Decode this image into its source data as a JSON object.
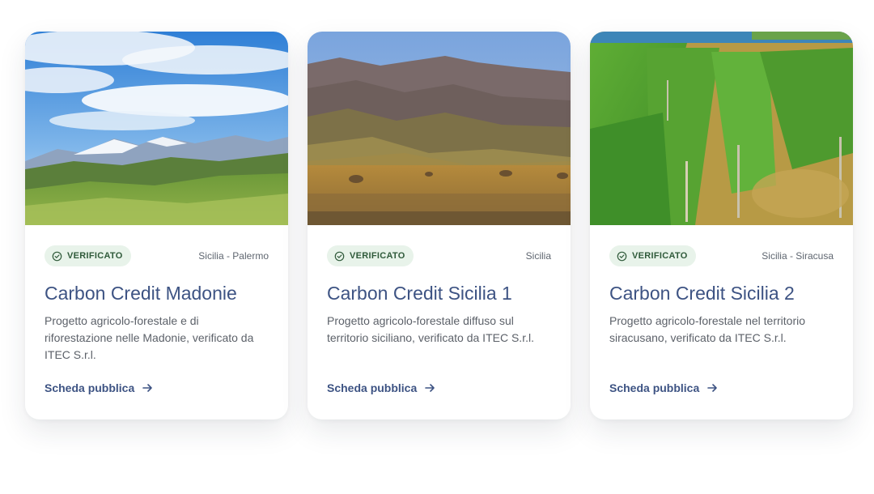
{
  "cards": [
    {
      "badge": "VERIFICATO",
      "location": "Sicilia - Palermo",
      "title": "Carbon Credit Madonie",
      "description": "Progetto agricolo-forestale e di riforestazione nelle Madonie, verificato da ITEC S.r.l.",
      "link": "Scheda pubblica",
      "image": "mountain-landscape-photo"
    },
    {
      "badge": "VERIFICATO",
      "location": "Sicilia",
      "title": "Carbon Credit Sicilia 1",
      "description": "Progetto agricolo-forestale diffuso sul territorio siciliano, verificato da ITEC S.r.l.",
      "link": "Scheda pubblica",
      "image": "hills-hay-bales-photo"
    },
    {
      "badge": "VERIFICATO",
      "location": "Sicilia - Siracusa",
      "title": "Carbon Credit Sicilia 2",
      "description": "Progetto agricolo-forestale nel territorio siracusano, verificato da ITEC S.r.l.",
      "link": "Scheda pubblica",
      "image": "vineyard-photo"
    }
  ],
  "colors": {
    "accent": "#3d5383",
    "badge_bg": "#e8f3ea",
    "badge_text": "#2f5a3a"
  }
}
